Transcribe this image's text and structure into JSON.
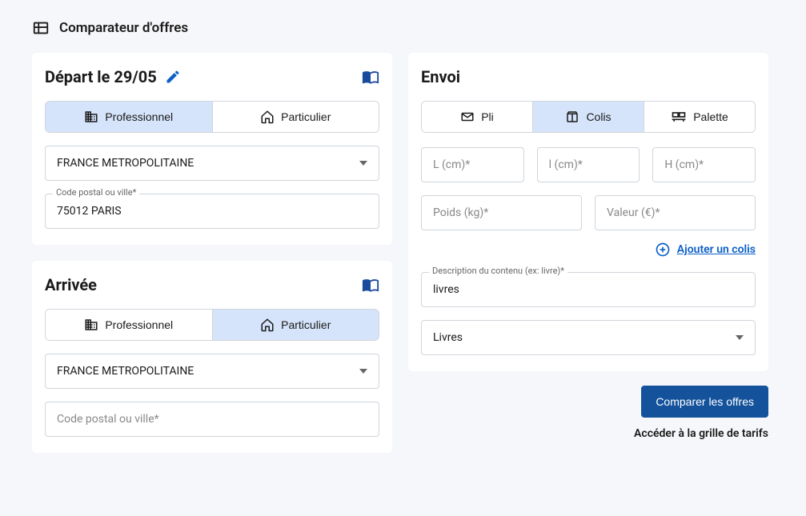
{
  "page": {
    "title": "Comparateur d'offres"
  },
  "depart": {
    "title_prefix": "Départ le ",
    "date": "29/05",
    "tabs": {
      "pro": "Professionnel",
      "part": "Particulier"
    },
    "country": "FRANCE METROPOLITAINE",
    "postal": {
      "label": "Code postal ou ville*",
      "value": "75012 PARIS"
    }
  },
  "arrivee": {
    "title": "Arrivée",
    "tabs": {
      "pro": "Professionnel",
      "part": "Particulier"
    },
    "country": "FRANCE METROPOLITAINE",
    "postal": {
      "placeholder": "Code postal ou ville*",
      "value": ""
    }
  },
  "envoi": {
    "title": "Envoi",
    "tabs": {
      "pli": "Pli",
      "colis": "Colis",
      "palette": "Palette"
    },
    "dims": {
      "l": "L (cm)*",
      "w": "l (cm)*",
      "h": "H (cm)*"
    },
    "weight": "Poids (kg)*",
    "value": "Valeur (€)*",
    "add": "Ajouter un colis",
    "desc": {
      "label": "Description du contenu (ex: livre)*",
      "value": "livres"
    },
    "category": "Livres"
  },
  "actions": {
    "compare": "Comparer les offres",
    "tariff": "Accéder à la grille de tarifs"
  }
}
